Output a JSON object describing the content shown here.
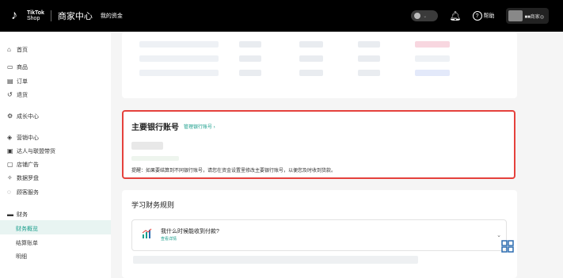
{
  "topbar": {
    "logo_line1": "TikTok",
    "logo_line2": "Shop",
    "brand": "商家中心",
    "nav": "我的资金",
    "account_text": "■■商家◎",
    "help_label": "帮助",
    "help_badge": "?"
  },
  "sidebar": {
    "items": [
      {
        "label": "首页",
        "icon": "home-icon",
        "glyph": "⌂"
      },
      {
        "label": "商品",
        "icon": "box-icon",
        "glyph": "▭"
      },
      {
        "label": "订单",
        "icon": "order-icon",
        "glyph": "▤"
      },
      {
        "label": "退货",
        "icon": "return-icon",
        "glyph": "↺"
      },
      {
        "label": "成长中心",
        "icon": "growth-icon",
        "glyph": "⚙"
      },
      {
        "label": "营销中心",
        "icon": "marketing-icon",
        "glyph": "◈"
      },
      {
        "label": "达人与联盟带货",
        "icon": "affiliate-icon",
        "glyph": "▣"
      },
      {
        "label": "店铺广告",
        "icon": "ads-icon",
        "glyph": "▢"
      },
      {
        "label": "数据罗盘",
        "icon": "compass-icon",
        "glyph": "✧"
      },
      {
        "label": "顾客服务",
        "icon": "service-icon",
        "glyph": "◌"
      },
      {
        "label": "财务",
        "icon": "finance-icon",
        "glyph": "▬"
      },
      {
        "label": "财务概览",
        "sub": true,
        "active": true
      },
      {
        "label": "结算账单",
        "sub": true
      },
      {
        "label": "明细",
        "sub": true
      }
    ]
  },
  "bank": {
    "title": "主要银行账号",
    "link": "管理银行账号 ›",
    "note": "提醒：如果要结算到不同银行账号，请您在资金设置里修改主要银行账号，以便您及时收到货款。"
  },
  "rules": {
    "title": "学习财务规则",
    "faq_question": "我什么时候能收到付款?",
    "faq_more": "查看详情"
  },
  "colors": {
    "accent": "#1a9e8c",
    "highlight_border": "#e5413c"
  }
}
